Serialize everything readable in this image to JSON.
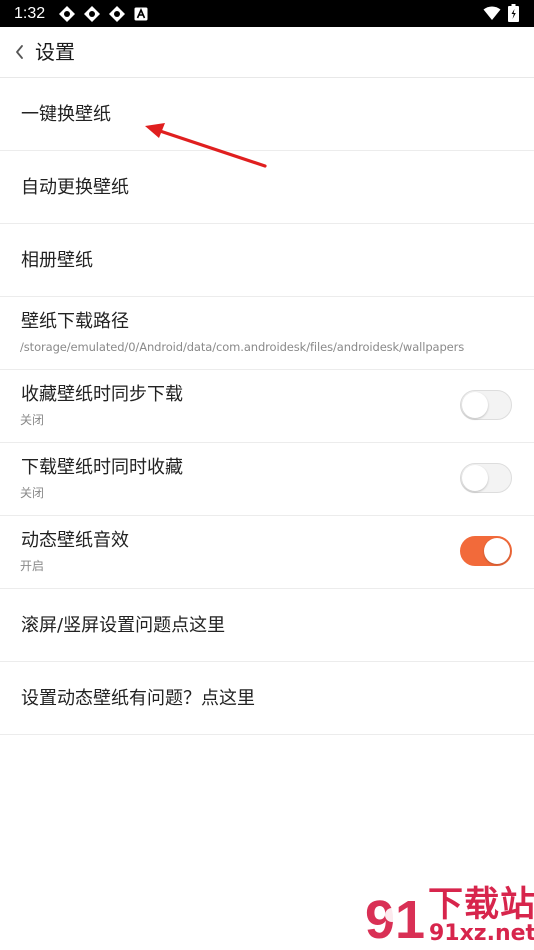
{
  "status_bar": {
    "time": "1:32",
    "notification_icons": [
      "app-icon",
      "app-icon",
      "app-icon",
      "a-icon"
    ],
    "system_icons": [
      "wifi-icon",
      "battery-icon"
    ]
  },
  "header": {
    "title": "设置",
    "back_icon": "chevron-left-icon"
  },
  "settings": [
    {
      "title": "一键换壁纸"
    },
    {
      "title": "自动更换壁纸"
    },
    {
      "title": "相册壁纸"
    },
    {
      "title": "壁纸下载路径",
      "subtitle": "/storage/emulated/0/Android/data/com.androidesk/files/androidesk/wallpapers"
    },
    {
      "title": "收藏壁纸时同步下载",
      "subtitle": "关闭",
      "toggle": false
    },
    {
      "title": "下载壁纸时同时收藏",
      "subtitle": "关闭",
      "toggle": false
    },
    {
      "title": "动态壁纸音效",
      "subtitle": "开启",
      "toggle": true
    },
    {
      "title": "滚屏/竖屏设置问题点这里"
    },
    {
      "title": "设置动态壁纸有问题？点这里"
    }
  ],
  "annotation": {
    "arrow_color": "#e01f1f"
  },
  "watermark": {
    "logo_text": "91",
    "title": "下载站",
    "url": "91xz.net",
    "color": "#d7254c"
  },
  "colors": {
    "accent": "#f26a3a",
    "background": "#ffffff",
    "status_bar": "#000000"
  }
}
